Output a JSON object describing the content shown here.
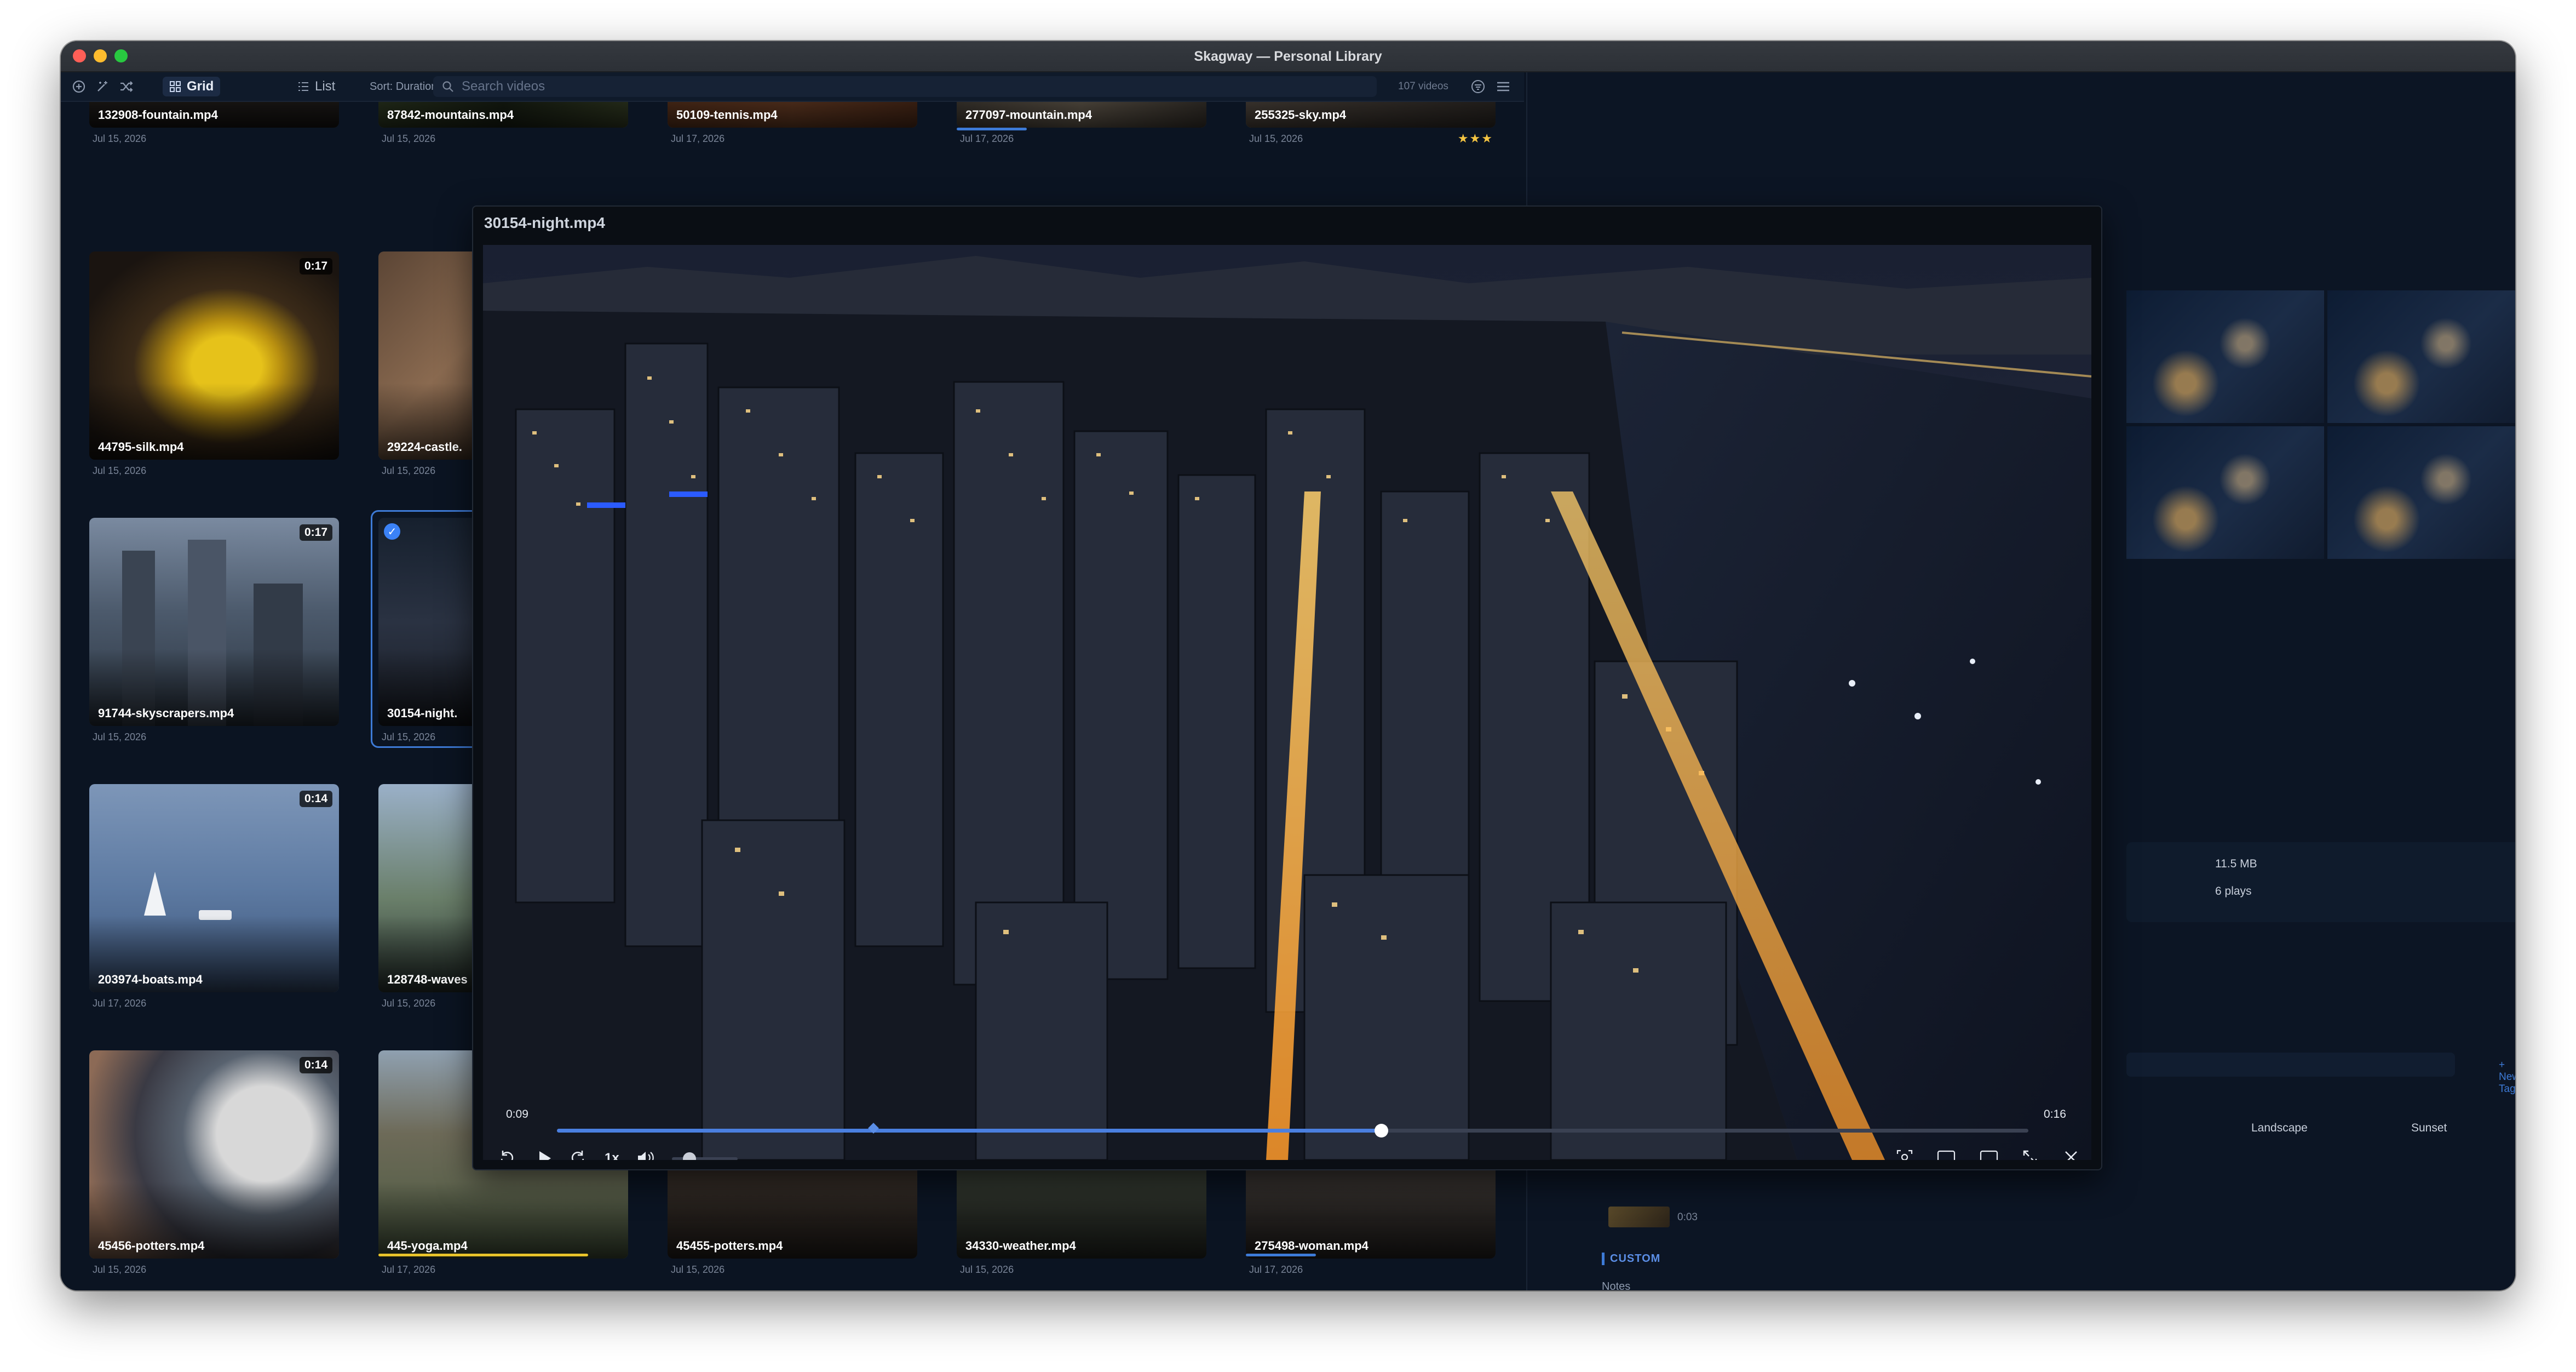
{
  "window": {
    "title": "Skagway — Personal Library"
  },
  "toolbar": {
    "grid_label": "Grid",
    "list_label": "List",
    "sort_label": "Sort: Duration",
    "search_placeholder": "Search videos",
    "video_count": "107 videos"
  },
  "grid": {
    "row0": [
      {
        "name": "132908-fountain.mp4",
        "date": "Jul 15, 2026"
      },
      {
        "name": "87842-mountains.mp4",
        "date": "Jul 15, 2026"
      },
      {
        "name": "50109-tennis.mp4",
        "date": "Jul 17, 2026"
      },
      {
        "name": "277097-mountain.mp4",
        "date": "Jul 17, 2026",
        "watched": 0.28
      },
      {
        "name": "255325-sky.mp4",
        "date": "Jul 15, 2026",
        "stars": "★★★"
      }
    ],
    "row1": [
      {
        "name": "44795-silk.mp4",
        "date": "Jul 15, 2026",
        "duration": "0:17"
      },
      {
        "name": "29224-castle.",
        "date": "Jul 15, 2026"
      }
    ],
    "row2": [
      {
        "name": "91744-skyscrapers.mp4",
        "date": "Jul 15, 2026",
        "duration": "0:17"
      },
      {
        "name": "30154-night.",
        "date": "Jul 15, 2026",
        "selected": true
      }
    ],
    "row3": [
      {
        "name": "203974-boats.mp4",
        "date": "Jul 17, 2026",
        "duration": "0:14"
      },
      {
        "name": "128748-waves",
        "date": "Jul 15, 2026"
      }
    ],
    "row4": [
      {
        "name": "45456-potters.mp4",
        "date": "Jul 15, 2026",
        "duration": "0:14"
      },
      {
        "name": "445-yoga.mp4",
        "date": "Jul 17, 2026",
        "watched": 0.84
      },
      {
        "name": "45455-potters.mp4",
        "date": "Jul 15, 2026"
      },
      {
        "name": "34330-weather.mp4",
        "date": "Jul 15, 2026"
      },
      {
        "name": "275498-woman.mp4",
        "date": "Jul 17, 2026",
        "watched": 0.28
      }
    ]
  },
  "sidebar": {
    "size": "11.5 MB",
    "plays": "6 plays",
    "new_tag": "+ New Tag",
    "tags": [
      "Landscape",
      "Sunset"
    ],
    "mini_time": "0:03",
    "custom_label": "CUSTOM",
    "notes_label": "Notes"
  },
  "player": {
    "title": "30154-night.mp4",
    "current_time": "0:09",
    "total_time": "0:16",
    "speed": "1x",
    "progress": 0.56,
    "marker": 0.215,
    "volume": 0.18
  },
  "colors": {
    "accent": "#3d7ad6",
    "window_bg": "#0b1422",
    "star": "#f5c542"
  }
}
